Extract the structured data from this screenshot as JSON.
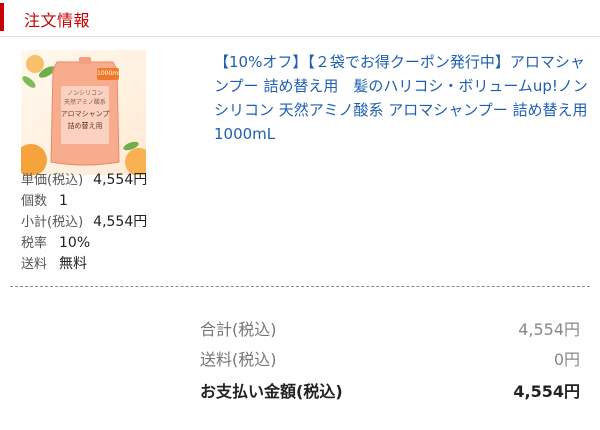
{
  "section": {
    "title": "注文情報",
    "accent_color": "#c80000"
  },
  "product": {
    "image_text": {
      "badge": "1000mL",
      "line1": "ノンシリコン",
      "line2": "天然アミノ酸系",
      "line3": "アロマシャンプー",
      "line4": "詰め替え用"
    },
    "title": "【10%オフ】【２袋でお得クーポン発行中】アロマシャンプー 詰め替え用　髪のハリコシ・ボリュームup!ノンシリコン 天然アミノ酸系 アロマシャンプー 詰め替え用 1000mL",
    "link_color": "#1e5fb4"
  },
  "details": [
    {
      "label": "単価(税込)",
      "value": "4,554円"
    },
    {
      "label": "個数",
      "value": "1"
    },
    {
      "label": "小計(税込)",
      "value": "4,554円"
    },
    {
      "label": "税率",
      "value": "10%"
    },
    {
      "label": "送料",
      "value": "無料"
    }
  ],
  "summary": {
    "subtotal": {
      "label": "合計(税込)",
      "value": "4,554円"
    },
    "shipping": {
      "label": "送料(税込)",
      "value": "0円"
    },
    "total": {
      "label": "お支払い金額(税込)",
      "value": "4,554円"
    }
  }
}
